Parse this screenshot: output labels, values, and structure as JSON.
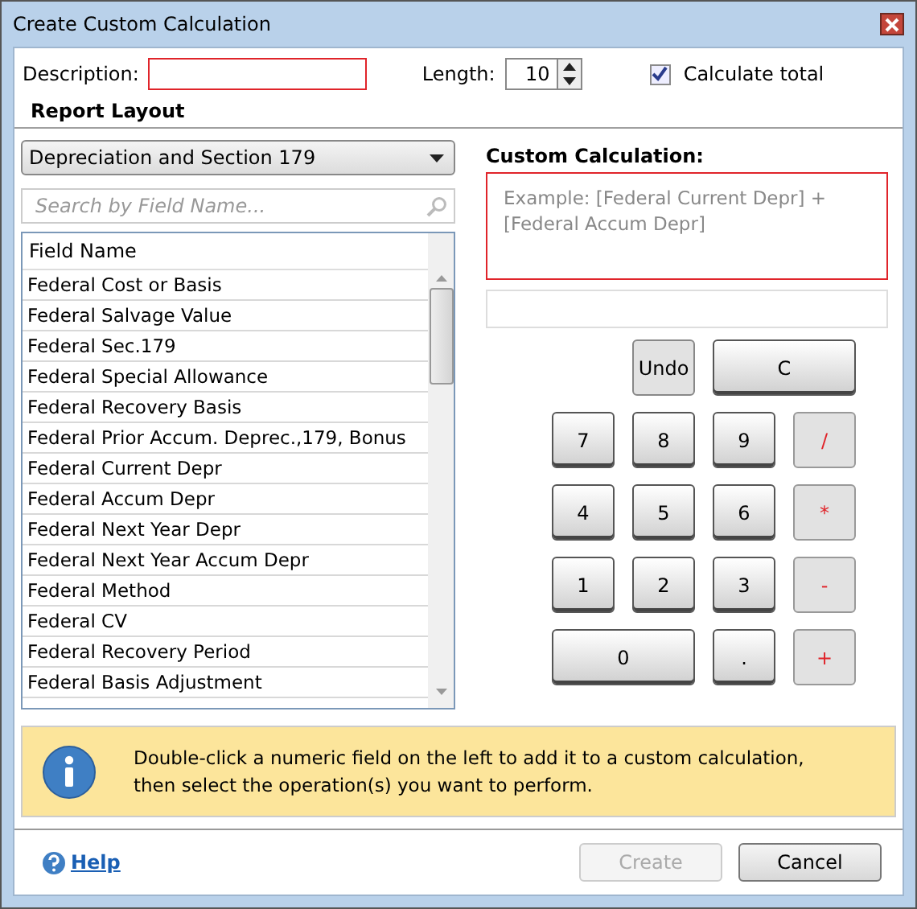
{
  "window": {
    "title": "Create Custom Calculation"
  },
  "description": {
    "label": "Description:",
    "invalid": true
  },
  "length": {
    "label": "Length:",
    "value": "10"
  },
  "calculate_total": {
    "label": "Calculate total",
    "checked": true
  },
  "report_layout": {
    "heading": "Report Layout",
    "dropdown": "Depreciation and Section 179",
    "search_placeholder": "Search by Field Name..."
  },
  "field_list": {
    "column": "Field Name",
    "rows": [
      "Federal Cost or Basis",
      "Federal Salvage Value",
      "Federal Sec.179",
      "Federal Special Allowance",
      "Federal Recovery Basis",
      "Federal Prior Accum. Deprec.,179, Bonus",
      "Federal Current Depr",
      "Federal Accum Depr",
      "Federal Next Year Depr",
      "Federal Next Year Accum Depr",
      "Federal Method",
      "Federal CV",
      "Federal Recovery Period",
      "Federal Basis Adjustment"
    ]
  },
  "custom_calculation": {
    "label": "Custom Calculation:",
    "placeholder": "Example: [Federal Current Depr] + [Federal Accum Depr]",
    "invalid": true
  },
  "keypad": [
    {
      "label": "Undo",
      "kind": "action",
      "wide": false
    },
    {
      "label": "C",
      "kind": "action",
      "wide": true
    },
    {
      "label": "7",
      "kind": "digit",
      "wide": false
    },
    {
      "label": "8",
      "kind": "digit",
      "wide": false
    },
    {
      "label": "9",
      "kind": "digit",
      "wide": false
    },
    {
      "label": "/",
      "kind": "operator",
      "wide": false
    },
    {
      "label": "4",
      "kind": "digit",
      "wide": false
    },
    {
      "label": "5",
      "kind": "digit",
      "wide": false
    },
    {
      "label": "6",
      "kind": "digit",
      "wide": false
    },
    {
      "label": "*",
      "kind": "operator",
      "wide": false
    },
    {
      "label": "1",
      "kind": "digit",
      "wide": false
    },
    {
      "label": "2",
      "kind": "digit",
      "wide": false
    },
    {
      "label": "3",
      "kind": "digit",
      "wide": false
    },
    {
      "label": "-",
      "kind": "operator",
      "wide": false
    },
    {
      "label": "0",
      "kind": "digit",
      "wide": true
    },
    {
      "label": ".",
      "kind": "digit",
      "wide": false
    },
    {
      "label": "+",
      "kind": "operator",
      "wide": false
    }
  ],
  "info": "Double-click a numeric field on the left to add it to a custom calculation, then select the operation(s) you want to perform.",
  "help": "Help",
  "buttons": [
    {
      "label": "Create",
      "disabled": true
    },
    {
      "label": "Cancel",
      "disabled": false
    }
  ]
}
